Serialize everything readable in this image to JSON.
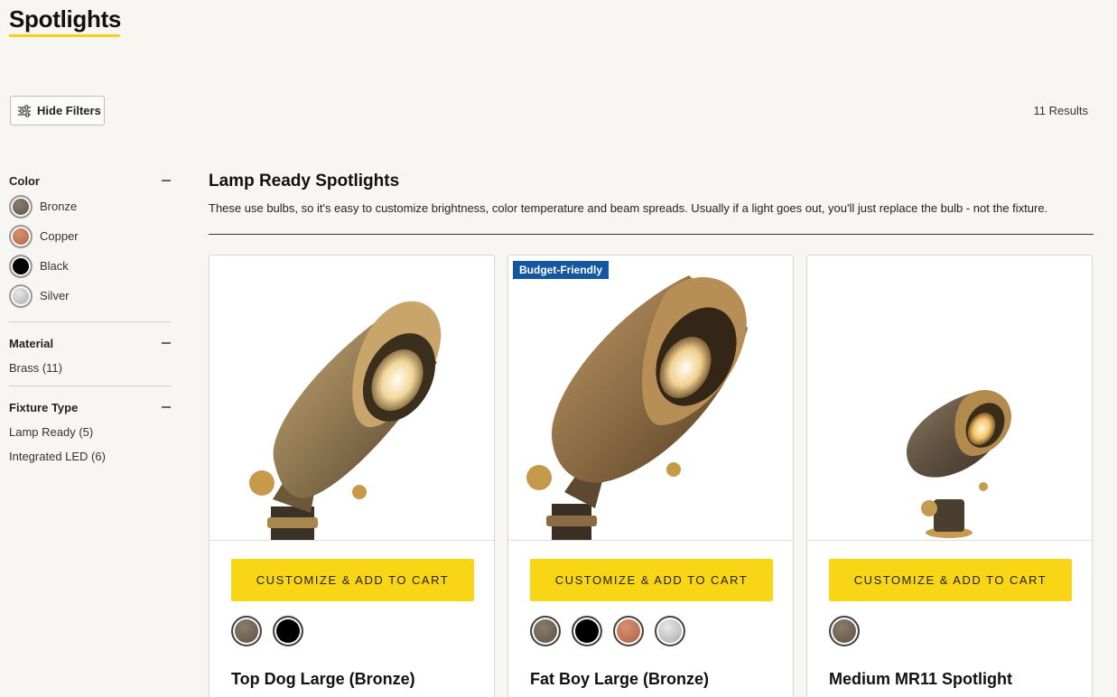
{
  "page": {
    "title": "Spotlights",
    "hide_filters_label": "Hide Filters",
    "results_label": "11 Results"
  },
  "filters": {
    "color": {
      "heading": "Color",
      "options": [
        {
          "label": "Bronze",
          "swatch": "bronze"
        },
        {
          "label": "Copper",
          "swatch": "copper"
        },
        {
          "label": "Black",
          "swatch": "black"
        },
        {
          "label": "Silver",
          "swatch": "silver"
        }
      ]
    },
    "material": {
      "heading": "Material",
      "options": [
        {
          "label": "Brass (11)"
        }
      ]
    },
    "fixture_type": {
      "heading": "Fixture Type",
      "options": [
        {
          "label": "Lamp Ready (5)"
        },
        {
          "label": "Integrated LED (6)"
        }
      ]
    }
  },
  "section": {
    "title": "Lamp Ready Spotlights",
    "description": "These use bulbs, so it's easy to customize brightness, color temperature and beam spreads. Usually if a light goes out, you'll just replace the bulb - not the fixture."
  },
  "products": [
    {
      "name": "Top Dog Large (Bronze)",
      "badge": "",
      "cta": "CUSTOMIZE & ADD TO CART",
      "swatches": [
        "bronze",
        "black"
      ]
    },
    {
      "name": "Fat Boy Large (Bronze)",
      "badge": "Budget-Friendly",
      "cta": "CUSTOMIZE & ADD TO CART",
      "swatches": [
        "bronze",
        "black",
        "copper",
        "silver"
      ]
    },
    {
      "name": "Medium MR11 Spotlight",
      "badge": "",
      "cta": "CUSTOMIZE & ADD TO CART",
      "swatches": [
        "bronze"
      ]
    }
  ],
  "colors": {
    "accent_yellow": "#f8d616",
    "badge_blue": "#1457a0",
    "bronze": "#6b5e4f",
    "copper": "#c27654",
    "black": "#000000",
    "silver": "#c6c6c6"
  }
}
